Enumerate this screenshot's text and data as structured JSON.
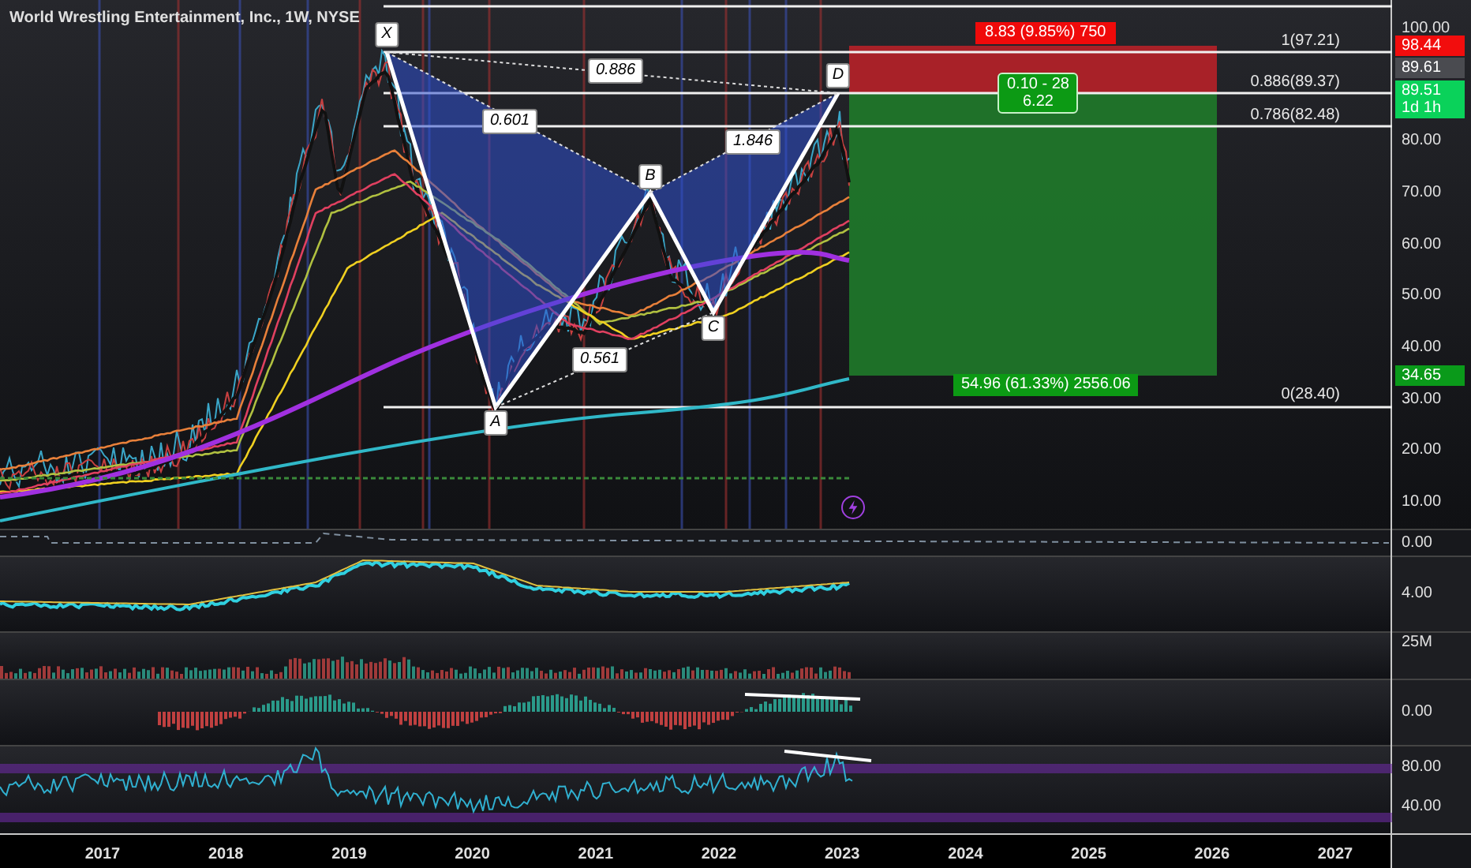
{
  "chart_header": {
    "title": "World Wrestling Entertainment, Inc., 1W, NYSE"
  },
  "pattern": {
    "points": [
      {
        "label": "X"
      },
      {
        "label": "A"
      },
      {
        "label": "B"
      },
      {
        "label": "C"
      },
      {
        "label": "D"
      }
    ],
    "ratios": [
      {
        "label": "0.886"
      },
      {
        "label": "0.601"
      },
      {
        "label": "1.846"
      },
      {
        "label": "0.561"
      }
    ]
  },
  "fib_levels": [
    {
      "label": "1(97.21)"
    },
    {
      "label": "0.886(89.37)"
    },
    {
      "label": "0.786(82.48)"
    },
    {
      "label": "0(28.40)"
    }
  ],
  "position": {
    "risk_label": "8.83 (9.85%) 750",
    "ratio_lines": [
      "0.10 - 28",
      "6.22"
    ],
    "reward_label": "54.96 (61.33%) 2556.06"
  },
  "price_axis": {
    "ticks": [
      "100.00",
      "80.00",
      "70.00",
      "60.00",
      "50.00",
      "40.00",
      "30.00",
      "20.00",
      "10.00"
    ],
    "badges": [
      {
        "lines": [
          "98.44"
        ],
        "color": "#f20d0d"
      },
      {
        "lines": [
          "89.61"
        ],
        "color": "#4a4b50"
      },
      {
        "lines": [
          "89.51",
          "1d 1h"
        ],
        "color": "#0ad25a"
      },
      {
        "lines": [
          "34.65"
        ],
        "color": "#0a9a1a"
      }
    ]
  },
  "indicator_panels": [
    {
      "ticks": [
        "0.00"
      ]
    },
    {
      "ticks": [
        "4.00"
      ]
    },
    {
      "ticks": [
        "25M"
      ]
    },
    {
      "ticks": [
        "0.00"
      ]
    },
    {
      "ticks": [
        "80.00",
        "40.00"
      ]
    }
  ],
  "time_axis": {
    "labels": [
      "2017",
      "2018",
      "2019",
      "2020",
      "2021",
      "2022",
      "2023",
      "2024",
      "2025",
      "2026",
      "2027"
    ]
  }
}
